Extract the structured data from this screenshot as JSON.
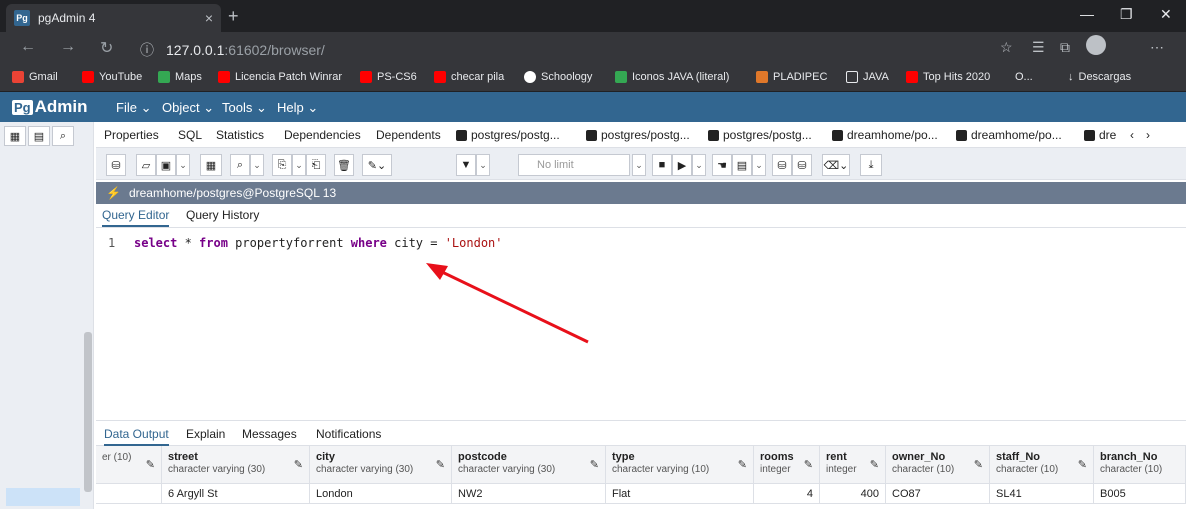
{
  "browser": {
    "tab_title": "pgAdmin 4",
    "tab_favicon": "Pg",
    "tab_close": "×",
    "new_tab": "+",
    "url_host": "127.0.0.1",
    "url_rest": ":61602/browser/",
    "bookmarks": [
      "Gmail",
      "YouTube",
      "Maps",
      "Licencia Patch Winrar",
      "PS-CS6",
      "checar pila",
      "Schoology",
      "Iconos JAVA (literal)",
      "PLADIPEC",
      "JAVA",
      "Top Hits 2020",
      "O...",
      "Descargas"
    ]
  },
  "pgadmin": {
    "logo_pg": "Pg",
    "logo_text": "Admin",
    "menus": [
      "File",
      "Object",
      "Tools",
      "Help"
    ],
    "panel_tabs": [
      "Properties",
      "SQL",
      "Statistics",
      "Dependencies",
      "Dependents",
      "postgres/postg...",
      "postgres/postg...",
      "postgres/postg...",
      "dreamhome/po...",
      "dreamhome/po...",
      "dre"
    ],
    "limit_label": "No limit",
    "connection": "dreamhome/postgres@PostgreSQL 13",
    "query_tabs": [
      "Query Editor",
      "Query History"
    ],
    "editor": {
      "line_number": "1",
      "kw_select": "select",
      "star": " * ",
      "kw_from": "from",
      "table": " propertyforrent ",
      "kw_where": "where",
      "cond": " city = ",
      "literal": "'London'"
    },
    "data_tabs": [
      "Data Output",
      "Explain",
      "Messages",
      "Notifications"
    ],
    "columns": [
      {
        "name": "",
        "type": "er (10)"
      },
      {
        "name": "street",
        "type": "character varying (30)"
      },
      {
        "name": "city",
        "type": "character varying (30)"
      },
      {
        "name": "postcode",
        "type": "character varying (30)"
      },
      {
        "name": "type",
        "type": "character varying (10)"
      },
      {
        "name": "rooms",
        "type": "integer"
      },
      {
        "name": "rent",
        "type": "integer"
      },
      {
        "name": "owner_No",
        "type": "character (10)"
      },
      {
        "name": "staff_No",
        "type": "character (10)"
      },
      {
        "name": "branch_No",
        "type": "character (10)"
      }
    ],
    "row": [
      "",
      "6 Argyll St",
      "London",
      "NW2",
      "Flat",
      "4",
      "400",
      "CO87",
      "SL41",
      "B005"
    ]
  },
  "colors": {
    "brand": "#326690",
    "arrow": "#e8101a"
  }
}
